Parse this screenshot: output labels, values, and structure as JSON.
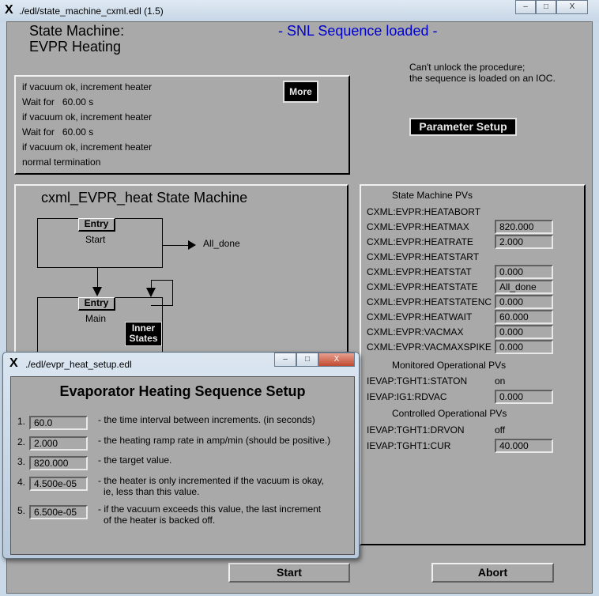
{
  "main_window": {
    "title": "./edl/state_machine_cxml.edl (1.5)",
    "icon": "x-window-icon"
  },
  "header": {
    "title_line1": "State Machine:",
    "title_line2": "EVPR Heating",
    "status": "- SNL Sequence loaded -",
    "status_color": "#0000cc",
    "lock_msg_line1": "Can't unlock the procedure;",
    "lock_msg_line2": "the sequence is loaded on an IOC."
  },
  "log": {
    "lines": [
      "if vacuum ok, increment heater",
      "Wait for   60.00 s",
      "if vacuum ok, increment heater",
      "Wait for   60.00 s",
      "if vacuum ok, increment heater",
      "normal termination"
    ],
    "more_label": "More"
  },
  "parameter_setup_label": "Parameter Setup",
  "diagram": {
    "title": "cxml_EVPR_heat State Machine",
    "states": [
      {
        "name": "Start",
        "entry": "Entry"
      },
      {
        "name": "Main",
        "entry": "Entry",
        "inner": "Inner States"
      }
    ],
    "exit_label": "All_done"
  },
  "pvs": {
    "sm_header": "State Machine PVs",
    "sm_rows": [
      {
        "name": "CXML:EVPR:HEATABORT",
        "value": null
      },
      {
        "name": "CXML:EVPR:HEATMAX",
        "value": "820.000"
      },
      {
        "name": "CXML:EVPR:HEATRATE",
        "value": "2.000"
      },
      {
        "name": "CXML:EVPR:HEATSTART",
        "value": null
      },
      {
        "name": "CXML:EVPR:HEATSTAT",
        "value": "0.000"
      },
      {
        "name": "CXML:EVPR:HEATSTATE",
        "value": "All_done"
      },
      {
        "name": "CXML:EVPR:HEATSTATENC",
        "value": "0.000"
      },
      {
        "name": "CXML:EVPR:HEATWAIT",
        "value": "60.000"
      },
      {
        "name": "CXML:EVPR:VACMAX",
        "value": "0.000"
      },
      {
        "name": "CXML:EVPR:VACMAXSPIKE",
        "value": "0.000"
      }
    ],
    "mon_header": "Monitored Operational PVs",
    "mon_rows": [
      {
        "name": "IEVAP:TGHT1:STATON",
        "text": "on"
      },
      {
        "name": "IEVAP:IG1:RDVAC",
        "value": "0.000"
      }
    ],
    "ctl_header": "Controlled Operational PVs",
    "ctl_rows": [
      {
        "name": "IEVAP:TGHT1:DRVON",
        "text": "off"
      },
      {
        "name": "IEVAP:TGHT1:CUR",
        "value": "40.000"
      }
    ]
  },
  "buttons": {
    "start": "Start",
    "abort": "Abort"
  },
  "dialog": {
    "title": "./edl/evpr_heat_setup.edl",
    "heading": "Evaporator Heating Sequence Setup",
    "rows": [
      {
        "num": "1.",
        "value": "60.0",
        "desc": "- the time interval between increments. (in seconds)"
      },
      {
        "num": "2.",
        "value": "2.000",
        "desc": "- the heating ramp rate in amp/min (should be positive.)"
      },
      {
        "num": "3.",
        "value": "820.000",
        "desc": "- the target value."
      },
      {
        "num": "4.",
        "value": "4.500e-05",
        "desc": "- the heater is only incremented if the vacuum is okay,",
        "desc2": "ie, less than this value."
      },
      {
        "num": "5.",
        "value": "6.500e-05",
        "desc": "- if the vacuum exceeds this value, the last increment",
        "desc2": "of the heater is backed off."
      }
    ]
  }
}
